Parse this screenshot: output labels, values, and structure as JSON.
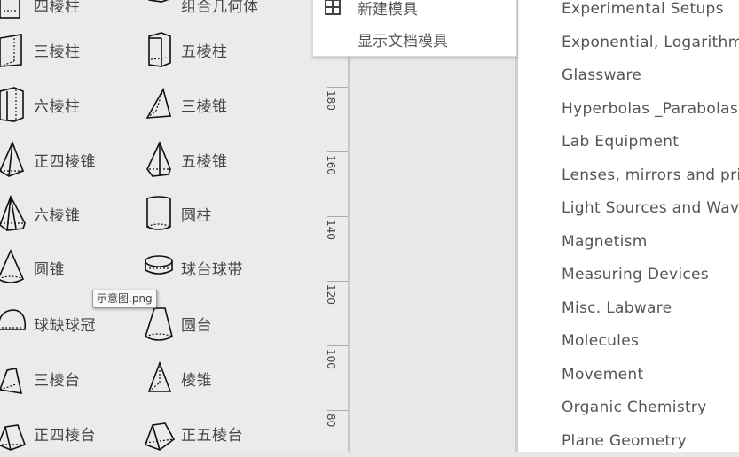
{
  "library": {
    "rows": [
      [
        {
          "label": "四棱柱",
          "icon": "quadrangular-prism-icon"
        },
        {
          "label": "组合几何体",
          "icon": "composite-solid-icon"
        }
      ],
      [
        {
          "label": "三棱柱",
          "icon": "triangular-prism-icon"
        },
        {
          "label": "五棱柱",
          "icon": "pentagonal-prism-icon"
        }
      ],
      [
        {
          "label": "六棱柱",
          "icon": "hexagonal-prism-icon"
        },
        {
          "label": "三棱锥",
          "icon": "triangular-pyramid-icon"
        }
      ],
      [
        {
          "label": "正四棱锥",
          "icon": "square-pyramid-icon"
        },
        {
          "label": "五棱锥",
          "icon": "pentagonal-pyramid-icon"
        }
      ],
      [
        {
          "label": "六棱锥",
          "icon": "hexagonal-pyramid-icon"
        },
        {
          "label": "圆柱",
          "icon": "cylinder-icon"
        }
      ],
      [
        {
          "label": "圆锥",
          "icon": "cone-icon"
        },
        {
          "label": "球台球带",
          "icon": "spherical-segment-icon"
        }
      ],
      [
        {
          "label": "球缺球冠",
          "icon": "spherical-cap-icon"
        },
        {
          "label": "圆台",
          "icon": "frustum-cone-icon"
        }
      ],
      [
        {
          "label": "三棱台",
          "icon": "triangular-frustum-icon"
        },
        {
          "label": "棱锥",
          "icon": "pyramid-icon"
        }
      ],
      [
        {
          "label": "正四棱台",
          "icon": "square-frustum-icon"
        },
        {
          "label": "正五棱台",
          "icon": "pentagonal-frustum-icon"
        }
      ]
    ]
  },
  "tooltip": {
    "text": "示意图.png"
  },
  "context_menu": {
    "items": [
      {
        "label": "新建模具",
        "icon": "grid-icon"
      },
      {
        "label": "显示文档模具",
        "icon": ""
      }
    ]
  },
  "ruler": {
    "labels": [
      "180",
      "160",
      "140",
      "120",
      "100",
      "80"
    ]
  },
  "categories": [
    "Experimental Setups",
    "Exponential, Logarithm",
    "Glassware",
    "Hyperbolas _Parabolas",
    "Lab Equipment",
    "Lenses, mirrors and pri",
    "Light Sources and Wav",
    "Magnetism",
    "Measuring Devices",
    "Misc. Labware",
    "Molecules",
    "Movement",
    "Organic Chemistry",
    "Plane Geometry"
  ]
}
